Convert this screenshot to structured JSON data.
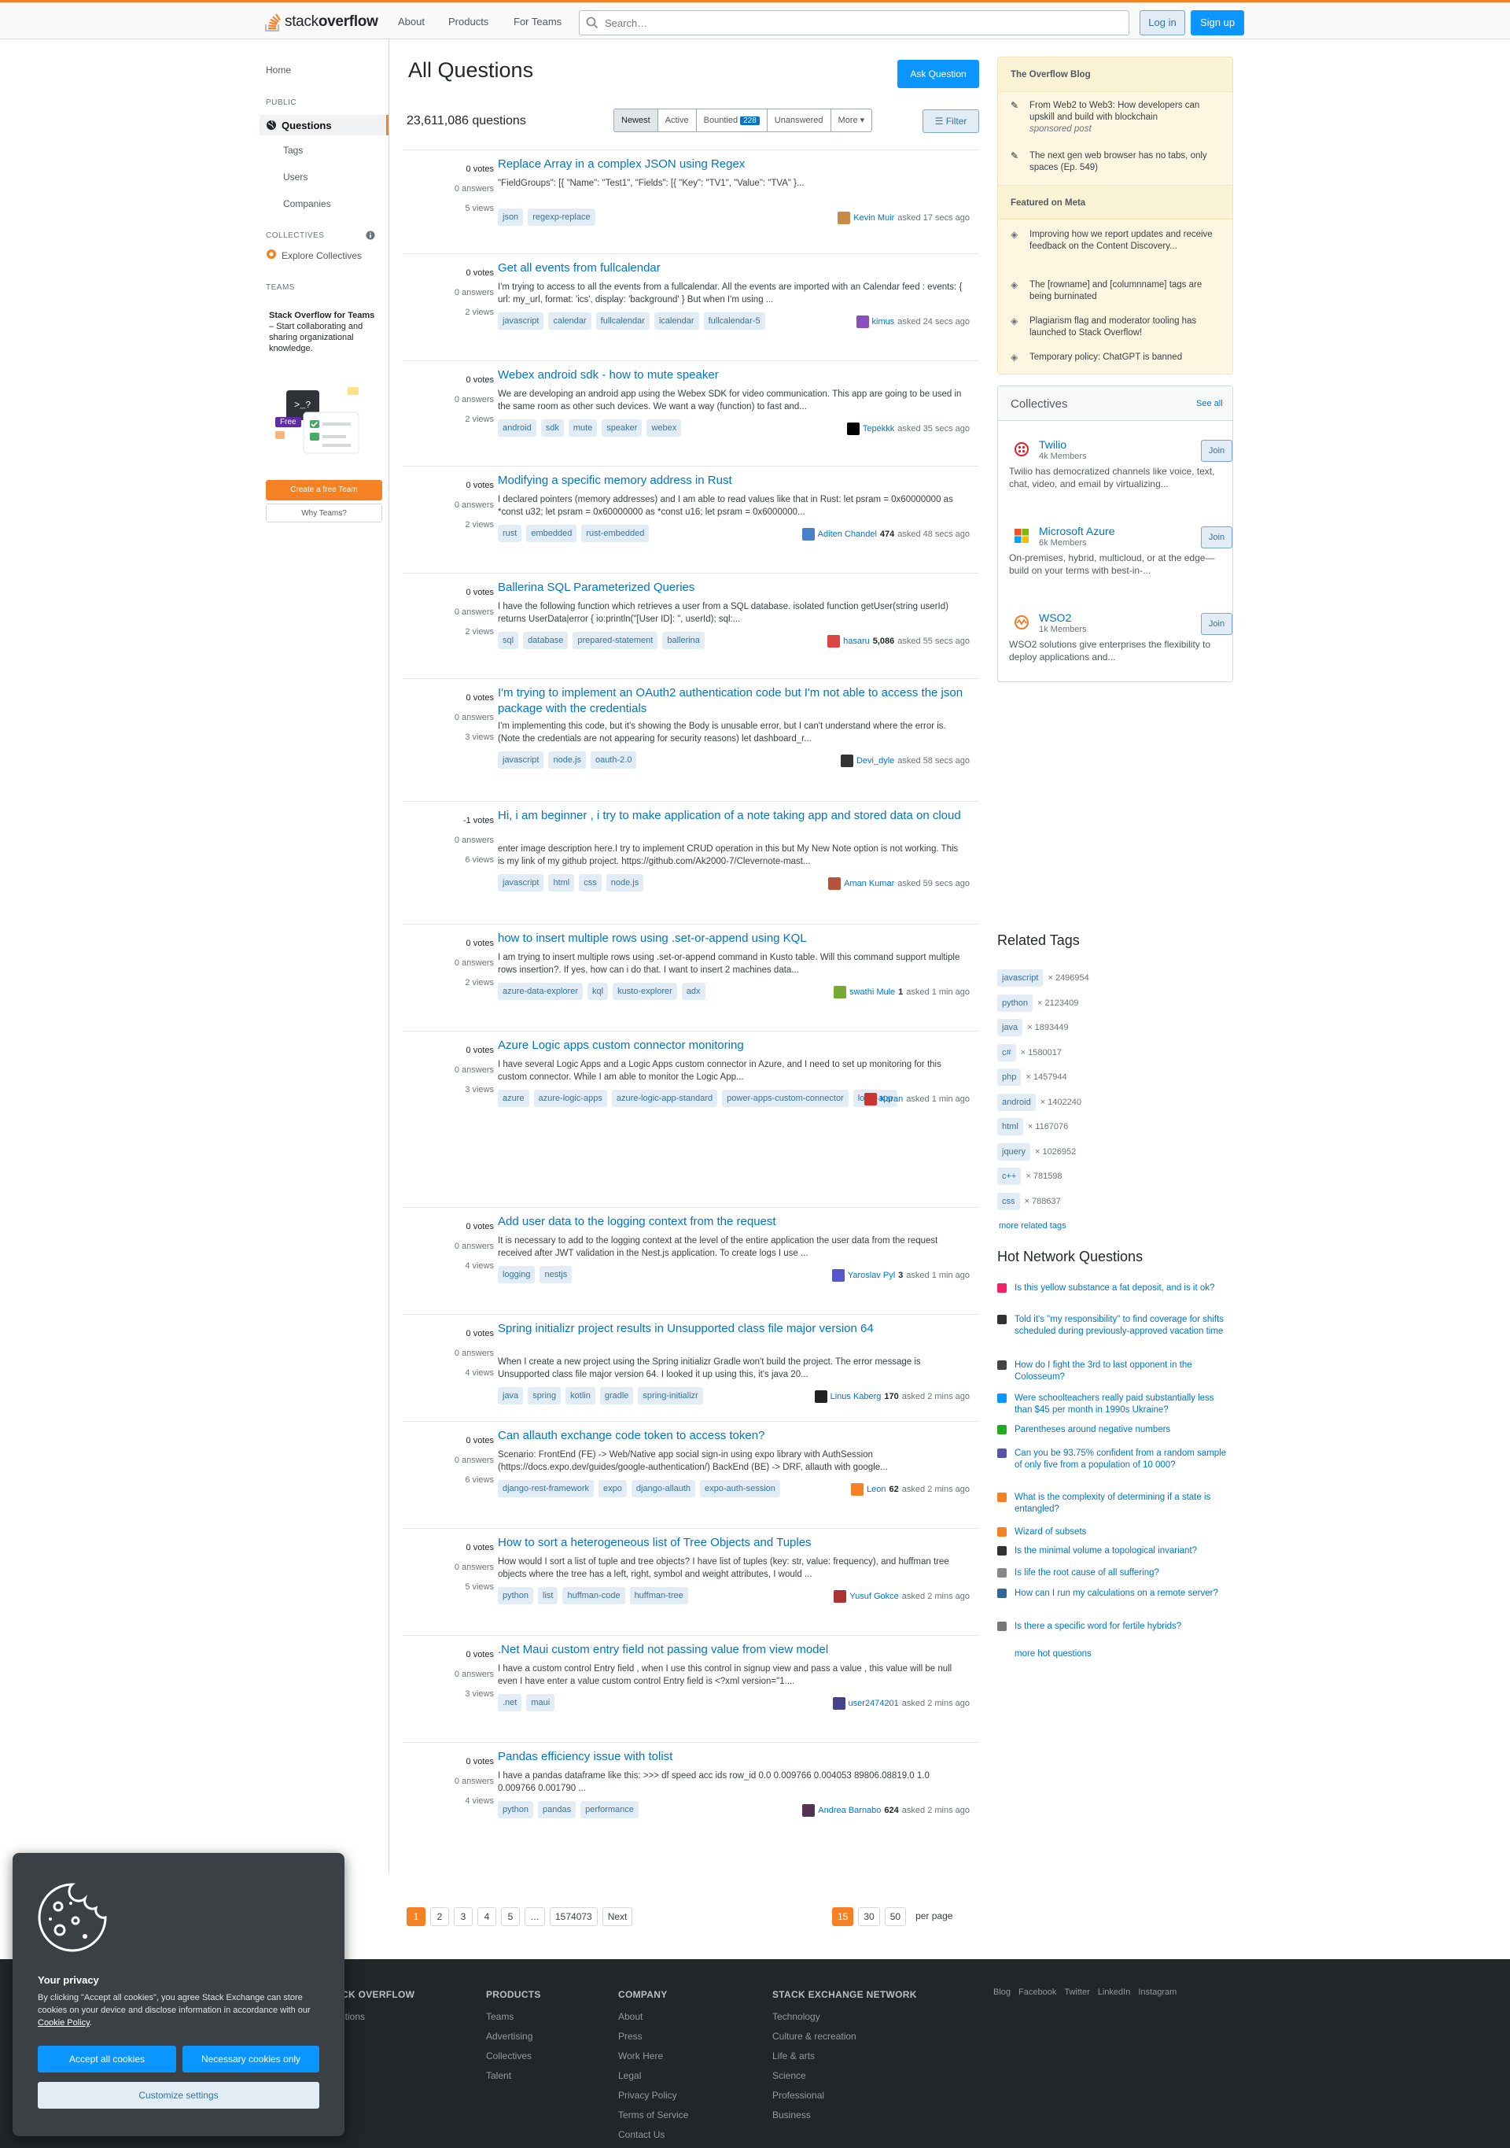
{
  "header": {
    "logo_text": "stack",
    "logo_bold": "overflow",
    "nav": [
      "About",
      "Products",
      "For Teams"
    ],
    "search_placeholder": "Search…",
    "login": "Log in",
    "signup": "Sign up",
    "accent": "#f48225",
    "primary": "#0a95ff"
  },
  "left_nav": {
    "home": "Home",
    "public": "PUBLIC",
    "questions": "Questions",
    "tags": "Tags",
    "users": "Users",
    "companies": "Companies",
    "collectives_head": "COLLECTIVES",
    "explore": "Explore Collectives",
    "teams_head": "TEAMS",
    "teams_title": "Stack Overflow for Teams",
    "teams_dash": " – Start collaborating and sharing organizational knowledge.",
    "free": "Free",
    "create_team": "Create a free Team",
    "why_teams": "Why Teams?"
  },
  "main": {
    "title": "All Questions",
    "ask": "Ask Question",
    "count": "23,611,086 questions",
    "filters": {
      "newest": "Newest",
      "active": "Active",
      "bountied": "Bountied",
      "bountied_count": "228",
      "unanswered": "Unanswered",
      "more": "More"
    },
    "filter_btn": "Filter"
  },
  "questions": [
    {
      "votes": "0 votes",
      "answers": "0 answers",
      "views": "5 views",
      "title": "Replace Array in a complex JSON using Regex",
      "excerpt": "\"FieldGroups\": [{ \"Name\": \"Test1\", \"Fields\": [{ \"Key\": \"TV1\", \"Value\": \"TVA\" }...",
      "tags": [
        "json",
        "regexp-replace"
      ],
      "user": "Kevin Muir",
      "rep": "",
      "time": "asked 17 secs ago"
    },
    {
      "votes": "0 votes",
      "answers": "0 answers",
      "views": "2 views",
      "title": "Get all events from fullcalendar",
      "excerpt": "I'm trying to access to all the events from a fullcalendar. All the events are imported with an Calendar feed : events: { url: my_url, format: 'ics', display: 'background' } But when I'm using ...",
      "tags": [
        "javascript",
        "calendar",
        "fullcalendar",
        "icalendar",
        "fullcalendar-5"
      ],
      "user": "kimus",
      "rep": "",
      "time": "asked 24 secs ago"
    },
    {
      "votes": "0 votes",
      "answers": "0 answers",
      "views": "2 views",
      "title": "Webex android sdk - how to mute speaker",
      "excerpt": "We are developing an android app using the Webex SDK for video communication. This app are going to be used in the same room as other such devices. We want a way (function) to fast and...",
      "tags": [
        "android",
        "sdk",
        "mute",
        "speaker",
        "webex"
      ],
      "user": "Tepekkk",
      "rep": "",
      "time": "asked 35 secs ago"
    },
    {
      "votes": "0 votes",
      "answers": "0 answers",
      "views": "2 views",
      "title": "Modifying a specific memory address in Rust",
      "excerpt": "I declared pointers (memory addresses) and I am able to read values like that in Rust: let psram = 0x60000000 as *const u32; let psram = 0x60000000 as *const u16; let psram = 0x6000000...",
      "tags": [
        "rust",
        "embedded",
        "rust-embedded"
      ],
      "user": "Aditen Chandel",
      "rep": "474",
      "time": "asked 48 secs ago"
    },
    {
      "votes": "0 votes",
      "answers": "0 answers",
      "views": "2 views",
      "title": "Ballerina SQL Parameterized Queries",
      "excerpt": "I have the following function which retrieves a user from a SQL database. isolated function getUser(string userId) returns UserData|error { io:println(\"[User ID]: \", userId); sql:...",
      "tags": [
        "sql",
        "database",
        "prepared-statement",
        "ballerina"
      ],
      "user": "hasaru",
      "rep": "5,086",
      "time": "asked 55 secs ago"
    },
    {
      "votes": "0 votes",
      "answers": "0 answers",
      "views": "3 views",
      "title": "I'm trying to implement an OAuth2 authentication code but I'm not able to access the json package with the credentials",
      "excerpt": "I'm implementing this code, but it's showing the Body is unusable error, but I can't understand where the error is. (Note the credentials are not appearing for security reasons) let dashboard_r...",
      "tags": [
        "javascript",
        "node.js",
        "oauth-2.0"
      ],
      "user": "Devi_dyle",
      "rep": "",
      "time": "asked 58 secs ago"
    },
    {
      "votes": "-1 votes",
      "answers": "0 answers",
      "views": "6 views",
      "title": "Hi, i am beginner , i try to make application of a note taking app and stored data on cloud",
      "excerpt": "enter image description here.I try to implement CRUD operation in this but My New Note option is not working. This is my link of my github project. https://github.com/Ak2000-7/Clevernote-mast...",
      "tags": [
        "javascript",
        "html",
        "css",
        "node.js"
      ],
      "user": "Aman Kumar",
      "rep": "",
      "time": "asked 59 secs ago"
    },
    {
      "votes": "0 votes",
      "answers": "0 answers",
      "views": "2 views",
      "title": "how to insert multiple rows using .set-or-append using KQL",
      "excerpt": "I am trying to insert multiple rows using .set-or-append command in Kusto table. Will this command support multiple rows insertion?. If yes, how can i do that. I want to insert 2 machines data...",
      "tags": [
        "azure-data-explorer",
        "kql",
        "kusto-explorer",
        "adx"
      ],
      "user": "swathi Mule",
      "rep": "1",
      "time": "asked 1 min ago"
    },
    {
      "votes": "0 votes",
      "answers": "0 answers",
      "views": "3 views",
      "title": "Azure Logic apps custom connector monitoring",
      "excerpt": "I have several Logic Apps and a Logic Apps custom connector in Azure, and I need to set up monitoring for this custom connector. While I am able to monitor the Logic App...",
      "tags": [
        "azure",
        "azure-logic-apps",
        "azure-logic-app-standard",
        "power-apps-custom-connector",
        "logic-app"
      ],
      "user": "Karan",
      "rep": "",
      "time": "asked 1 min ago"
    },
    {
      "votes": "0 votes",
      "answers": "0 answers",
      "views": "4 views",
      "title": "Add user data to the logging context from the request",
      "excerpt": "It is necessary to add to the logging context at the level of the entire application the user data from the request received after JWT validation in the Nest.js application. To create logs I use ...",
      "tags": [
        "logging",
        "nestjs"
      ],
      "user": "Yaroslav Pyl",
      "rep": "3",
      "time": "asked 1 min ago"
    },
    {
      "votes": "0 votes",
      "answers": "0 answers",
      "views": "4 views",
      "title": "Spring initializr project results in Unsupported class file major version 64",
      "excerpt": "When I create a new project using the Spring initializr Gradle won't build the project. The error message is Unsupported class file major version 64. I looked it up using this, it's java 20...",
      "tags": [
        "java",
        "spring",
        "kotlin",
        "gradle",
        "spring-initializr"
      ],
      "user": "Linus Kaberg",
      "rep": "170",
      "time": "asked 2 mins ago"
    },
    {
      "votes": "0 votes",
      "answers": "0 answers",
      "views": "6 views",
      "title": "Can allauth exchange code token to access token?",
      "excerpt": "Scenario: FrontEnd (FE) -> Web/Native app social sign-in using expo library with AuthSession (https://docs.expo.dev/guides/google-authentication/) BackEnd (BE) -> DRF, allauth with google...",
      "tags": [
        "django-rest-framework",
        "expo",
        "django-allauth",
        "expo-auth-session"
      ],
      "user": "Leon",
      "rep": "62",
      "time": "asked 2 mins ago"
    },
    {
      "votes": "0 votes",
      "answers": "0 answers",
      "views": "5 views",
      "title": "How to sort a heterogeneous list of Tree Objects and Tuples",
      "excerpt": "How would I sort a list of tuple and tree objects? I have list of tuples (key: str, value: frequency), and huffman tree objects where the tree has a left, right, symbol and weight attributes, I would ...",
      "tags": [
        "python",
        "list",
        "huffman-code",
        "huffman-tree"
      ],
      "user": "Yusuf Gokce",
      "rep": "",
      "time": "asked 2 mins ago"
    },
    {
      "votes": "0 votes",
      "answers": "0 answers",
      "views": "3 views",
      "title": ".Net Maui custom entry field not passing value from view model",
      "excerpt": "I have a custom control Entry field , when I use this control in signup view and pass a value , this value will be null even I have enter a value custom control Entry field is <?xml version=\"1....",
      "tags": [
        ".net",
        "maui"
      ],
      "user": "user2474201",
      "rep": "",
      "time": "asked 2 mins ago"
    },
    {
      "votes": "0 votes",
      "answers": "0 answers",
      "views": "4 views",
      "title": "Pandas efficiency issue with tolist",
      "excerpt": "I have a pandas dataframe like this: >>> df speed acc ids row_id 0.0 0.009766 0.004053 89806.08819.0 1.0 0.009766 0.001790 ...",
      "tags": [
        "python",
        "pandas",
        "performance"
      ],
      "user": "Andrea Barnabo",
      "rep": "624",
      "time": "asked 2 mins ago"
    }
  ],
  "pager": {
    "pages": [
      "1",
      "2",
      "3",
      "4",
      "5",
      "…",
      "1574073",
      "Next"
    ],
    "per_page": [
      "15",
      "30",
      "50"
    ],
    "per_page_label": "per page"
  },
  "blog": {
    "title": "The Overflow Blog",
    "items": [
      {
        "text": "From Web2 to Web3: How developers can upskill and build with blockchain",
        "sub": "sponsored post"
      },
      {
        "text": "The next gen web browser has no tabs, only spaces (Ep. 549)",
        "sub": ""
      }
    ],
    "meta_title": "Featured on Meta",
    "meta": [
      "Improving how we report updates and receive feedback on the Content Discovery...",
      "The [rowname] and [columnname] tags are being burninated",
      "Plagiarism flag and moderator tooling has launched to Stack Overflow!",
      "Temporary policy: ChatGPT is banned"
    ]
  },
  "collectives": {
    "title": "Collectives",
    "see_all": "See all",
    "items": [
      {
        "name": "Twilio",
        "members": "4k Members",
        "desc": "Twilio has democratized channels like voice, text, chat, video, and email by virtualizing...",
        "join": "Join"
      },
      {
        "name": "Microsoft Azure",
        "members": "6k Members",
        "desc": "On-premises, hybrid, multicloud, or at the edge—build on your terms with best-in-...",
        "join": "Join"
      },
      {
        "name": "WSO2",
        "members": "1k Members",
        "desc": "WSO2 solutions give enterprises the flexibility to deploy applications and...",
        "join": "Join"
      }
    ]
  },
  "related_tags": {
    "title": "Related Tags",
    "items": [
      {
        "tag": "javascript",
        "count": "× 2496954"
      },
      {
        "tag": "python",
        "count": "× 2123409"
      },
      {
        "tag": "java",
        "count": "× 1893449"
      },
      {
        "tag": "c#",
        "count": "× 1580017"
      },
      {
        "tag": "php",
        "count": "× 1457944"
      },
      {
        "tag": "android",
        "count": "× 1402240"
      },
      {
        "tag": "html",
        "count": "× 1167076"
      },
      {
        "tag": "jquery",
        "count": "× 1026952"
      },
      {
        "tag": "c++",
        "count": "× 781598"
      },
      {
        "tag": "css",
        "count": "× 788637"
      }
    ],
    "more": "more related tags"
  },
  "hot": {
    "title": "Hot Network Questions",
    "items": [
      "Is this yellow substance a fat deposit, and is it ok?",
      "Told it's \"my responsibility\" to find coverage for shifts scheduled during previously-approved vacation time",
      "How do I fight the 3rd to last opponent in the Colosseum?",
      "Were schoolteachers really paid substantially less than $45 per month in 1990s Ukraine?",
      "Parentheses around negative numbers",
      "Can you be 93.75% confident from a random sample of only five from a population of 10 000?",
      "What is the complexity of determining if a state is entangled?",
      "Wizard of subsets",
      "Is the minimal volume a topological invariant?",
      "Is life the root cause of all suffering?",
      "How can I run my calculations on a remote server?",
      "Is there a specific word for fertile hybrids?"
    ],
    "more": "more hot questions"
  },
  "footer": {
    "so_head": "STACK OVERFLOW",
    "so_links": [
      "Questions",
      "Help"
    ],
    "products_head": "PRODUCTS",
    "products": [
      "Teams",
      "Advertising",
      "Collectives",
      "Talent"
    ],
    "company_head": "COMPANY",
    "company": [
      "About",
      "Press",
      "Work Here",
      "Legal",
      "Privacy Policy",
      "Terms of Service",
      "Contact Us"
    ],
    "network_head": "STACK EXCHANGE NETWORK",
    "network": [
      "Technology",
      "Culture & recreation",
      "Life & arts",
      "Science",
      "Professional",
      "Business"
    ],
    "social": [
      "Blog",
      "Facebook",
      "Twitter",
      "LinkedIn",
      "Instagram"
    ]
  },
  "cookie": {
    "title": "Your privacy",
    "text": "By clicking \"Accept all cookies\", you agree Stack Exchange can store cookies on your device and disclose information in accordance with our ",
    "policy": "Cookie Policy",
    "accept": "Accept all cookies",
    "necessary": "Necessary cookies only",
    "customize": "Customize settings"
  }
}
